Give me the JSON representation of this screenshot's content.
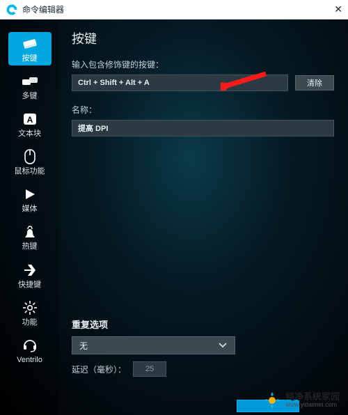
{
  "window": {
    "title": "命令编辑器",
    "close_glyph": "✕"
  },
  "sidebar": {
    "items": [
      {
        "id": "keystroke",
        "label": "按键",
        "selected": true
      },
      {
        "id": "multikey",
        "label": "多键"
      },
      {
        "id": "textblock",
        "label": "文本块"
      },
      {
        "id": "mouse",
        "label": "鼠标功能"
      },
      {
        "id": "media",
        "label": "媒体"
      },
      {
        "id": "hotkeys",
        "label": "热键"
      },
      {
        "id": "shortcut",
        "label": "快捷键"
      },
      {
        "id": "function",
        "label": "功能"
      },
      {
        "id": "ventrilo",
        "label": "Ventrilo"
      }
    ]
  },
  "main": {
    "page_title": "按键",
    "keystroke_label": "输入包含修饰键的按键：",
    "keystroke_value": "Ctrl + Shift + Alt + A",
    "clear_label": "清除",
    "name_label": "名称：",
    "name_value": "提高 DPI",
    "repeat_title": "重复选项",
    "repeat_value": "无",
    "delay_label": "延迟（毫秒）：",
    "delay_value": "25"
  },
  "watermark": {
    "cn": "纯净系统家园",
    "url": "www.yidaimei.com"
  }
}
